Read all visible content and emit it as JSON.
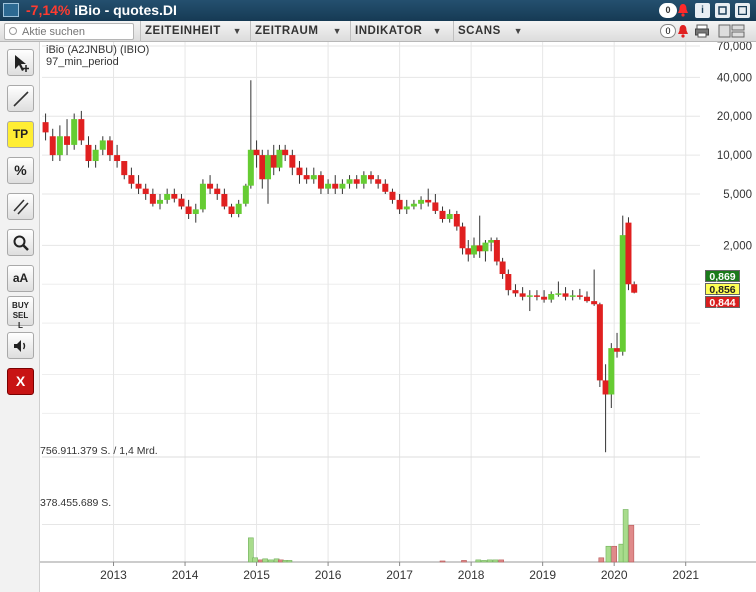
{
  "window": {
    "change": "-7,14%",
    "instrument": "iBio - quotes.DI",
    "alerts_count": "0",
    "info_label": "i"
  },
  "toolbar": {
    "search_placeholder": "Aktie suchen",
    "menus": [
      "ZEITEINHEIT",
      "ZEITRAUM",
      "INDIKATOR",
      "SCANS"
    ],
    "count": "0"
  },
  "sidebar": {
    "tools": [
      {
        "icon": "cursor-cross-icon",
        "label": ""
      },
      {
        "icon": "trendline-icon",
        "label": ""
      },
      {
        "icon": "target-price-icon",
        "label": "TP"
      },
      {
        "icon": "percent-icon",
        "label": "%"
      },
      {
        "icon": "parallel-lines-icon",
        "label": ""
      },
      {
        "icon": "zoom-icon",
        "label": ""
      },
      {
        "icon": "font-size-icon",
        "label": "aA"
      },
      {
        "icon": "buy-sell-icon",
        "label": "BUY SELL"
      },
      {
        "icon": "speaker-icon",
        "label": ""
      },
      {
        "icon": "close-icon",
        "label": "X"
      }
    ]
  },
  "chart": {
    "title": "iBio (A2JNBU) (IBIO)",
    "subtitle": "97_min_period",
    "vol_label_top": "756.911.379 S. / 1,4 Mrd.",
    "vol_label_mid": "378.455.689 S.",
    "price_tags": [
      {
        "value": "0,869",
        "bg": "#1a7a1a",
        "fg": "#ffffff"
      },
      {
        "value": "0,856",
        "bg": "#ffff55",
        "fg": "#222222"
      },
      {
        "value": "0,844",
        "bg": "#d81e1e",
        "fg": "#ffffff"
      }
    ]
  },
  "chart_data": {
    "type": "candlestick",
    "y_scale": "log",
    "y_ticks": [
      "70,000",
      "40,000",
      "20,000",
      "10,000",
      "5,000",
      "2,000"
    ],
    "x_ticks": [
      "2013",
      "2014",
      "2015",
      "2016",
      "2017",
      "2018",
      "2019",
      "2020",
      "2021"
    ],
    "colors": {
      "up": "#66cc33",
      "down": "#e02020",
      "vol_up": "#a8dc8c",
      "vol_down": "#e08a8a"
    },
    "candles": [
      [
        2012.05,
        18,
        21,
        13,
        15
      ],
      [
        2012.15,
        14,
        16,
        9,
        10
      ],
      [
        2012.25,
        10,
        17,
        9,
        14
      ],
      [
        2012.35,
        14,
        19,
        10,
        12
      ],
      [
        2012.45,
        12,
        21,
        11,
        19
      ],
      [
        2012.55,
        19,
        22,
        12,
        13
      ],
      [
        2012.65,
        12,
        14,
        8,
        9
      ],
      [
        2012.75,
        9,
        12,
        8,
        11
      ],
      [
        2012.85,
        11,
        14,
        10,
        13
      ],
      [
        2012.95,
        13,
        14,
        9,
        10
      ],
      [
        2013.05,
        10,
        12,
        8,
        9
      ],
      [
        2013.15,
        9,
        9,
        6.5,
        7
      ],
      [
        2013.25,
        7,
        8,
        5.5,
        6
      ],
      [
        2013.35,
        6,
        7,
        5,
        5.5
      ],
      [
        2013.45,
        5.5,
        6,
        4.5,
        5
      ],
      [
        2013.55,
        5,
        5.5,
        4,
        4.2
      ],
      [
        2013.65,
        4.2,
        5,
        3.8,
        4.5
      ],
      [
        2013.75,
        4.5,
        5.5,
        4.2,
        5
      ],
      [
        2013.85,
        5,
        5.5,
        4.3,
        4.6
      ],
      [
        2013.95,
        4.6,
        5,
        3.8,
        4
      ],
      [
        2014.05,
        4,
        4.5,
        3.2,
        3.5
      ],
      [
        2014.15,
        3.5,
        4.2,
        3,
        3.8
      ],
      [
        2014.25,
        3.8,
        6.5,
        3.6,
        6
      ],
      [
        2014.35,
        6,
        7,
        5,
        5.5
      ],
      [
        2014.45,
        5.5,
        6,
        4.5,
        5
      ],
      [
        2014.55,
        5,
        5.5,
        3.8,
        4
      ],
      [
        2014.65,
        4,
        4.2,
        3.3,
        3.5
      ],
      [
        2014.75,
        3.5,
        4.5,
        3.3,
        4.2
      ],
      [
        2014.85,
        4.2,
        6,
        4,
        5.8
      ],
      [
        2014.92,
        5.8,
        38,
        5.5,
        11
      ],
      [
        2015.0,
        11,
        13,
        8,
        10
      ],
      [
        2015.08,
        10,
        11,
        5.5,
        6.5
      ],
      [
        2015.16,
        6.5,
        11,
        4.2,
        10
      ],
      [
        2015.24,
        10,
        12,
        7,
        8
      ],
      [
        2015.32,
        8,
        12,
        7.5,
        11
      ],
      [
        2015.4,
        11,
        12,
        9,
        10
      ],
      [
        2015.5,
        10,
        11,
        7,
        8
      ],
      [
        2015.6,
        8,
        9,
        6,
        7
      ],
      [
        2015.7,
        7,
        8,
        6,
        6.5
      ],
      [
        2015.8,
        6.5,
        8,
        6,
        7
      ],
      [
        2015.9,
        7,
        7.5,
        5,
        5.5
      ],
      [
        2016.0,
        5.5,
        6.5,
        5,
        6
      ],
      [
        2016.1,
        6,
        7,
        5,
        5.5
      ],
      [
        2016.2,
        5.5,
        6.5,
        5,
        6
      ],
      [
        2016.3,
        6,
        7,
        5.5,
        6.5
      ],
      [
        2016.4,
        6.5,
        7,
        5.5,
        6
      ],
      [
        2016.5,
        6,
        7.5,
        5.5,
        7
      ],
      [
        2016.6,
        7,
        7.5,
        6,
        6.5
      ],
      [
        2016.7,
        6.5,
        7,
        5.5,
        6
      ],
      [
        2016.8,
        6,
        6.5,
        5,
        5.2
      ],
      [
        2016.9,
        5.2,
        5.5,
        4.2,
        4.5
      ],
      [
        2017.0,
        4.5,
        5,
        3.5,
        3.8
      ],
      [
        2017.1,
        3.8,
        4.5,
        3.5,
        4
      ],
      [
        2017.2,
        4,
        4.5,
        3.8,
        4.2
      ],
      [
        2017.3,
        4.2,
        4.8,
        3.8,
        4.5
      ],
      [
        2017.4,
        4.5,
        5.5,
        4,
        4.3
      ],
      [
        2017.5,
        4.3,
        5,
        3.5,
        3.7
      ],
      [
        2017.6,
        3.7,
        4,
        3,
        3.2
      ],
      [
        2017.7,
        3.2,
        3.8,
        3,
        3.5
      ],
      [
        2017.8,
        3.5,
        3.7,
        2.6,
        2.8
      ],
      [
        2017.88,
        2.8,
        3,
        1.7,
        1.9
      ],
      [
        2017.96,
        1.9,
        2.2,
        1.5,
        1.7
      ],
      [
        2018.04,
        1.7,
        2.3,
        1.6,
        2
      ],
      [
        2018.12,
        2,
        3.4,
        1.6,
        1.8
      ],
      [
        2018.2,
        1.8,
        2.2,
        1.5,
        2.1
      ],
      [
        2018.28,
        2.1,
        2.3,
        1.8,
        2.2
      ],
      [
        2018.36,
        2.2,
        2.3,
        1.4,
        1.5
      ],
      [
        2018.44,
        1.5,
        1.6,
        1.1,
        1.2
      ],
      [
        2018.52,
        1.2,
        1.3,
        0.82,
        0.9
      ],
      [
        2018.62,
        0.9,
        1,
        0.8,
        0.85
      ],
      [
        2018.72,
        0.85,
        0.95,
        0.75,
        0.8
      ],
      [
        2018.82,
        0.8,
        0.9,
        0.62,
        0.82
      ],
      [
        2018.92,
        0.82,
        0.9,
        0.75,
        0.8
      ],
      [
        2019.02,
        0.8,
        0.9,
        0.72,
        0.76
      ],
      [
        2019.12,
        0.76,
        0.88,
        0.72,
        0.84
      ],
      [
        2019.22,
        0.84,
        1.05,
        0.8,
        0.85
      ],
      [
        2019.32,
        0.85,
        0.95,
        0.75,
        0.8
      ],
      [
        2019.42,
        0.8,
        0.9,
        0.75,
        0.82
      ],
      [
        2019.52,
        0.82,
        0.92,
        0.76,
        0.8
      ],
      [
        2019.62,
        0.8,
        0.88,
        0.72,
        0.74
      ],
      [
        2019.72,
        0.74,
        1.3,
        0.68,
        0.7
      ],
      [
        2019.8,
        0.7,
        0.72,
        0.16,
        0.18
      ],
      [
        2019.88,
        0.18,
        0.24,
        0.05,
        0.14
      ],
      [
        2019.96,
        0.14,
        0.35,
        0.11,
        0.32
      ],
      [
        2020.04,
        0.32,
        0.42,
        0.27,
        0.3
      ],
      [
        2020.12,
        0.3,
        3.4,
        0.28,
        2.4
      ],
      [
        2020.2,
        3,
        3.3,
        0.9,
        1.0
      ],
      [
        2020.28,
        1.0,
        1.05,
        0.85,
        0.86
      ]
    ],
    "volume": [
      [
        2014.92,
        0.23,
        "up"
      ],
      [
        2014.98,
        0.04,
        "up"
      ],
      [
        2015.06,
        0.02,
        "down"
      ],
      [
        2015.12,
        0.03,
        "up"
      ],
      [
        2015.2,
        0.02,
        "up"
      ],
      [
        2015.28,
        0.03,
        "up"
      ],
      [
        2015.34,
        0.02,
        "down"
      ],
      [
        2015.4,
        0.015,
        "up"
      ],
      [
        2015.46,
        0.015,
        "up"
      ],
      [
        2017.6,
        0.01,
        "down"
      ],
      [
        2017.9,
        0.015,
        "down"
      ],
      [
        2018.1,
        0.02,
        "up"
      ],
      [
        2018.18,
        0.015,
        "up"
      ],
      [
        2018.26,
        0.02,
        "up"
      ],
      [
        2018.34,
        0.02,
        "up"
      ],
      [
        2018.42,
        0.02,
        "down"
      ],
      [
        2019.82,
        0.04,
        "down"
      ],
      [
        2019.92,
        0.15,
        "up"
      ],
      [
        2020.0,
        0.15,
        "down"
      ],
      [
        2020.1,
        0.17,
        "up"
      ],
      [
        2020.16,
        0.5,
        "up"
      ],
      [
        2020.24,
        0.35,
        "down"
      ]
    ]
  }
}
